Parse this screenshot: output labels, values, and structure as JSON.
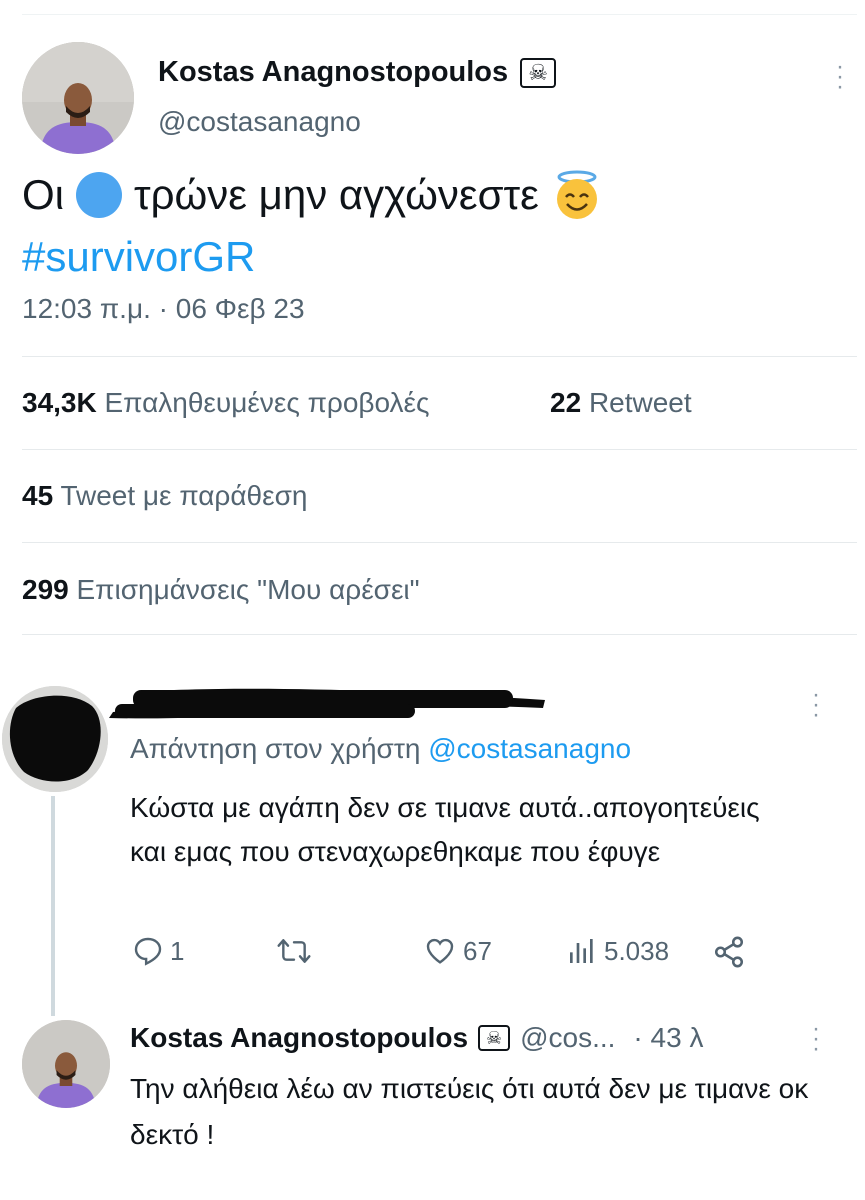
{
  "main_tweet": {
    "author_name": "Kostas Anagnostopoulos",
    "author_badge_icon": "skull-crossbones-icon",
    "handle": "@costasanagno",
    "text_before_emoji": "Οι",
    "text_after_emoji": "τρώνε μην αγχώνεστε",
    "hashtag": "#survivorGR",
    "timestamp": "12:03 π.μ. · 06 Φεβ 23",
    "stats": {
      "views_count": "34,3K",
      "views_label": "Επαληθευμένες προβολές",
      "retweets_count": "22",
      "retweets_label": "Retweet",
      "quotes_count": "45",
      "quotes_label": "Tweet με παράθεση",
      "likes_count": "299",
      "likes_label": "Επισημάνσεις \"Μου αρέσει\""
    }
  },
  "reply_1": {
    "reply_to_label": "Απάντηση στον χρήστη",
    "reply_to_mention": "@costasanagno",
    "text": "Κώστα με αγάπη δεν σε τιμανε αυτά..απογοητεύεις και εμας που στεναχωρεθηκαμε που έφυγε",
    "actions": {
      "replies": "1",
      "retweets": "",
      "likes": "67",
      "views": "5.038"
    }
  },
  "reply_2": {
    "author_name": "Kostas Anagnostopoulos",
    "handle": "@cos...",
    "time": "· 43 λ",
    "text": "Την αλήθεια λέω αν πιστεύεις ότι αυτά δεν με τιμανε οκ δεκτό !"
  },
  "colors": {
    "accent": "#1d9bf0",
    "muted_text": "#536471",
    "primary_text": "#0f1419",
    "blue_circle_emoji": "#4da5f0"
  }
}
